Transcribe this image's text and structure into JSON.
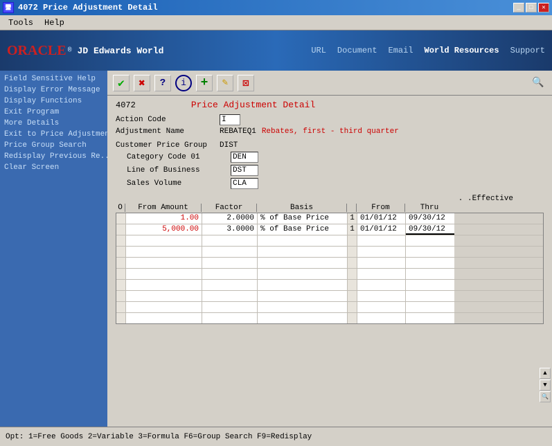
{
  "titlebar": {
    "icon": "4072",
    "title": "4072   Price Adjustment Detail",
    "min_label": "_",
    "max_label": "□",
    "close_label": "✕"
  },
  "menubar": {
    "items": [
      "Tools",
      "Help"
    ]
  },
  "oracle_header": {
    "logo_oracle": "ORACLE",
    "logo_jde": "JD Edwards World",
    "nav_items": [
      "URL",
      "Document",
      "Email",
      "World Resources",
      "Support"
    ]
  },
  "toolbar": {
    "check_icon": "✓",
    "x_icon": "✕",
    "help_icon": "?",
    "info_icon": "ℹ",
    "add_icon": "+",
    "edit_icon": "✎",
    "del_icon": "🗑",
    "search_icon": "🔍"
  },
  "sidebar": {
    "items": [
      "Field Sensitive Help",
      "Display Error Message",
      "Display Functions",
      "Exit Program",
      "More Details",
      "Exit to Price Adjustment",
      "Price Group Search",
      "Redisplay Previous Re...",
      "Clear Screen"
    ]
  },
  "form": {
    "app_number": "4072",
    "title": "Price Adjustment Detail",
    "action_code_label": "Action Code",
    "action_code_value": "I",
    "adjustment_name_label": "Adjustment Name",
    "adjustment_name_value": "REBATEQ1",
    "adjustment_name_desc": "Rebates, first - third quarter",
    "customer_price_group_label": "Customer Price Group",
    "customer_price_group_value": "DIST",
    "category_code_label": "Category Code 01",
    "category_code_value": "DEN",
    "line_of_business_label": "Line of Business",
    "line_of_business_value": "DST",
    "sales_volume_label": "Sales Volume",
    "sales_volume_value": "CLA"
  },
  "grid": {
    "effective_label": ". .Effective",
    "col_o": "O",
    "col_from_amount": "From Amount",
    "col_factor": "Factor",
    "col_basis": "Basis",
    "col_from": "From",
    "col_thru": "Thru",
    "rows": [
      {
        "o": "",
        "from_amount": "1.00",
        "factor": "2.0000",
        "basis": "% of Base Price",
        "basis_code": "1",
        "eff_from": "01/01/12",
        "eff_thru": "09/30/12"
      },
      {
        "o": "",
        "from_amount": "5,000.00",
        "factor": "3.0000",
        "basis": "% of Base Price",
        "basis_code": "1",
        "eff_from": "01/01/12",
        "eff_thru": "09/30/12"
      }
    ],
    "empty_rows": 8
  },
  "statusbar": {
    "text": "Opt:  1=Free Goods  2=Variable  3=Formula   F6=Group Search  F9=Redisplay"
  }
}
